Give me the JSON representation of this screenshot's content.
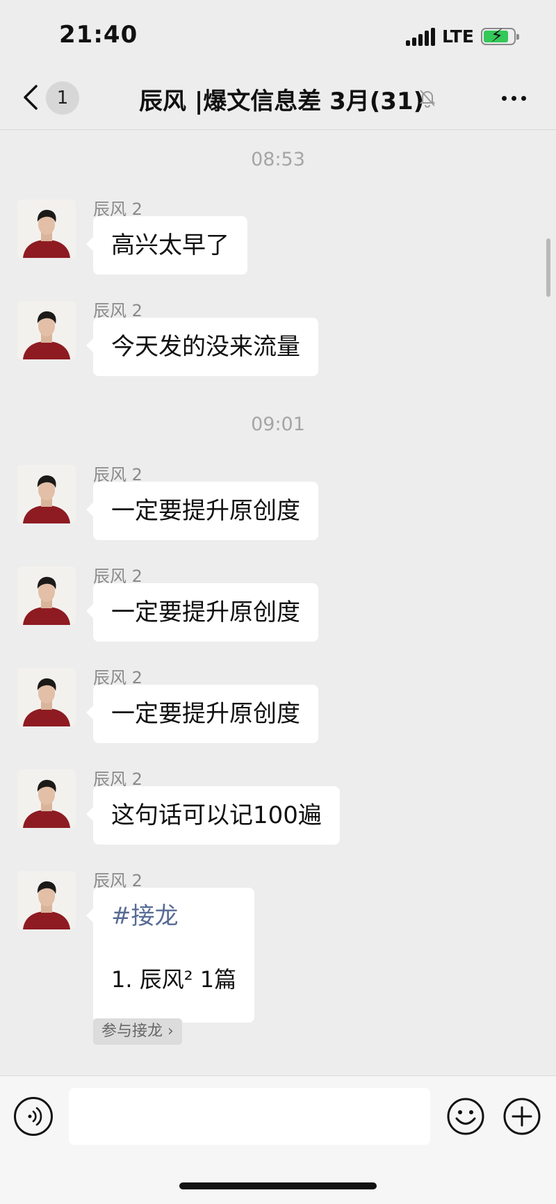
{
  "status_bar": {
    "time": "21:40",
    "network": "LTE",
    "battery": "charging"
  },
  "header": {
    "unread_count": "1",
    "title": "辰风 |爆文信息差 3月(31)",
    "muted": true
  },
  "timestamps": [
    "08:53",
    "09:01"
  ],
  "messages": [
    {
      "sender": "辰风 2",
      "text": "高兴太早了"
    },
    {
      "sender": "辰风 2",
      "text": "今天发的没来流量"
    },
    {
      "sender": "辰风 2",
      "text": "一定要提升原创度"
    },
    {
      "sender": "辰风 2",
      "text": "一定要提升原创度"
    },
    {
      "sender": "辰风 2",
      "text": "一定要提升原创度"
    },
    {
      "sender": "辰风 2",
      "text": "这句话可以记100遍"
    }
  ],
  "relay": {
    "sender": "辰风 2",
    "tag": "#接龙",
    "item": "1. 辰风² 1篇",
    "join_label": "参与接龙 ›"
  },
  "input": {
    "placeholder": ""
  },
  "colors": {
    "background": "#ededed",
    "bubble": "#ffffff",
    "link": "#576b95"
  }
}
